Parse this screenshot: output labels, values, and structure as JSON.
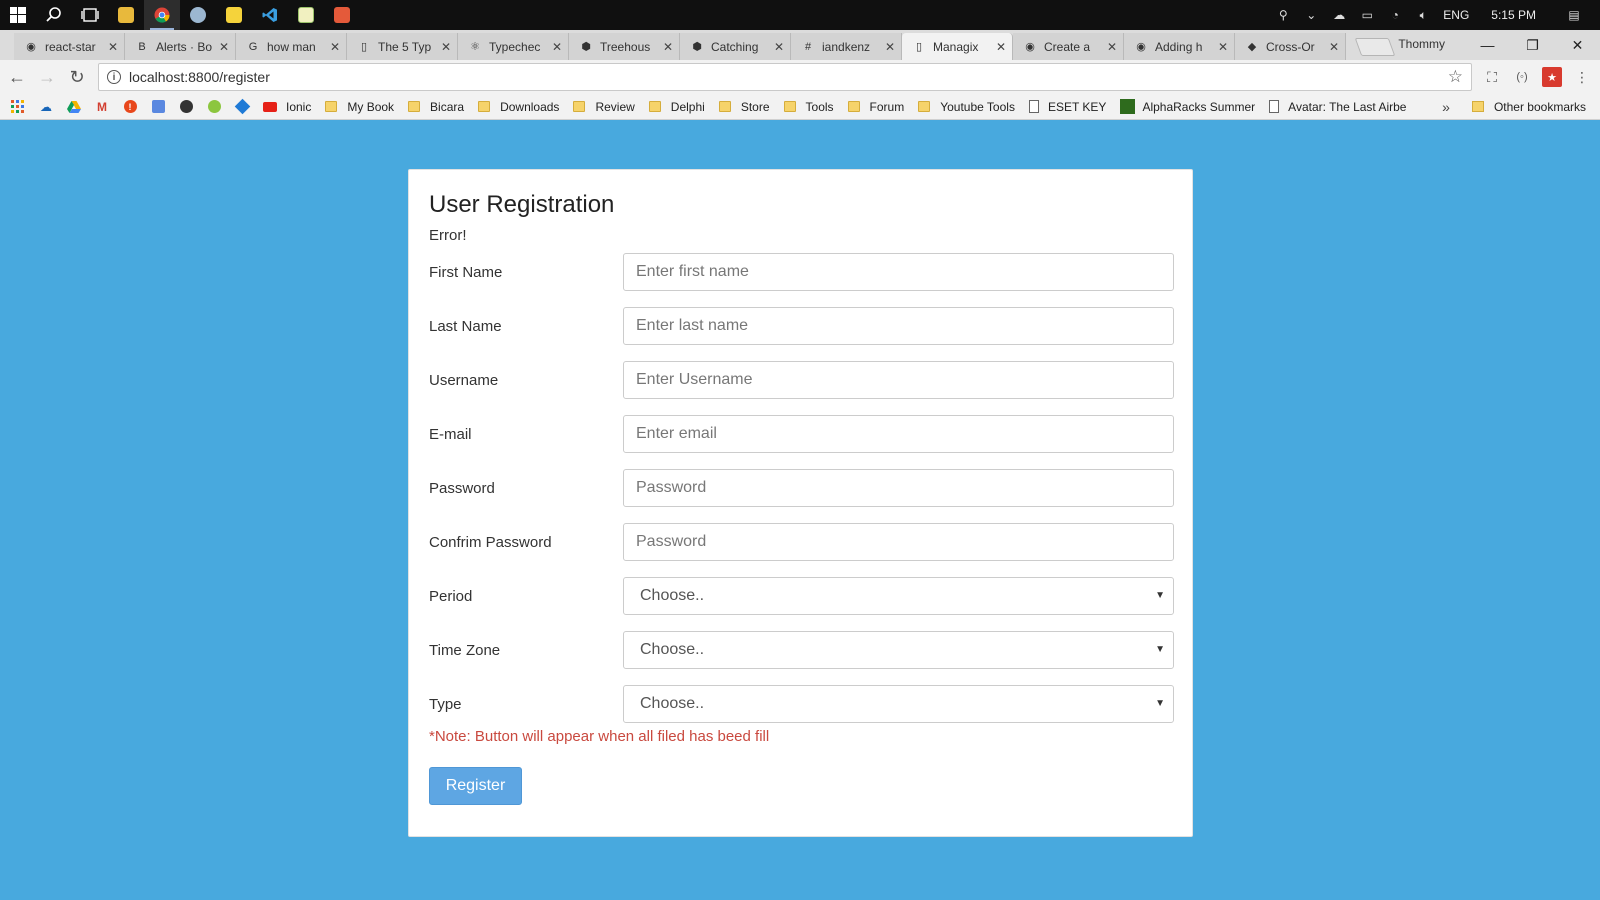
{
  "taskbar": {
    "apps": [
      {
        "icon": "windows-start-icon"
      },
      {
        "icon": "search-icon"
      },
      {
        "icon": "task-view-icon"
      },
      {
        "icon": "file-explorer-icon"
      },
      {
        "icon": "chrome-icon"
      },
      {
        "icon": "app-icon"
      },
      {
        "icon": "sticky-notes-icon"
      },
      {
        "icon": "vscode-icon"
      },
      {
        "icon": "notepad-icon"
      },
      {
        "icon": "app-icon"
      }
    ],
    "language": "ENG",
    "time": "5:15 PM"
  },
  "browser": {
    "tabs": [
      {
        "title": "react-star",
        "icon": "github-icon"
      },
      {
        "title": "Alerts · Bo",
        "icon": "bootstrap-icon"
      },
      {
        "title": "how man",
        "icon": "google-icon"
      },
      {
        "title": "The 5 Typ",
        "icon": "page-icon"
      },
      {
        "title": "Typechec",
        "icon": "react-icon"
      },
      {
        "title": "Treehous",
        "icon": "treehouse-icon"
      },
      {
        "title": "Catching",
        "icon": "treehouse-icon"
      },
      {
        "title": "iandkenz",
        "icon": "hash-icon"
      },
      {
        "title": "Managix",
        "icon": "page-icon",
        "active": true
      },
      {
        "title": "Create a",
        "icon": "github-icon"
      },
      {
        "title": "Adding h",
        "icon": "github-icon"
      },
      {
        "title": "Cross-Or",
        "icon": "bird-icon"
      }
    ],
    "profile_name": "Thommy",
    "url": "localhost:8800/register",
    "bookmarks": [
      {
        "label": "Ionic",
        "type": "site"
      },
      {
        "label": "My Book",
        "type": "folder"
      },
      {
        "label": "Bicara",
        "type": "folder"
      },
      {
        "label": "Downloads",
        "type": "folder"
      },
      {
        "label": "Review",
        "type": "folder"
      },
      {
        "label": "Delphi",
        "type": "folder"
      },
      {
        "label": "Store",
        "type": "folder"
      },
      {
        "label": "Tools",
        "type": "folder"
      },
      {
        "label": "Forum",
        "type": "folder"
      },
      {
        "label": "Youtube Tools",
        "type": "folder"
      },
      {
        "label": "ESET KEY",
        "type": "page"
      },
      {
        "label": "AlphaRacks Summer",
        "type": "site"
      },
      {
        "label": "Avatar: The Last Airbe",
        "type": "page"
      }
    ],
    "bookmarks_more": "»",
    "other_bookmarks": "Other bookmarks"
  },
  "form": {
    "title": "User Registration",
    "error": "Error!",
    "fields": [
      {
        "label": "First Name",
        "placeholder": "Enter first name"
      },
      {
        "label": "Last Name",
        "placeholder": "Enter last name"
      },
      {
        "label": "Username",
        "placeholder": "Enter Username"
      },
      {
        "label": "E-mail",
        "placeholder": "Enter email"
      },
      {
        "label": "Password",
        "placeholder": "Password"
      },
      {
        "label": "Confrim Password",
        "placeholder": "Password"
      }
    ],
    "selects": [
      {
        "label": "Period",
        "value": "Choose.."
      },
      {
        "label": "Time Zone",
        "value": "Choose.."
      },
      {
        "label": "Type",
        "value": "Choose.."
      }
    ],
    "note": "*Note: Button will appear when all filed has beed fill",
    "submit_label": "Register"
  },
  "colors": {
    "page_background": "#48a9de",
    "button": "#5ea6e3",
    "note": "#c9493f"
  }
}
